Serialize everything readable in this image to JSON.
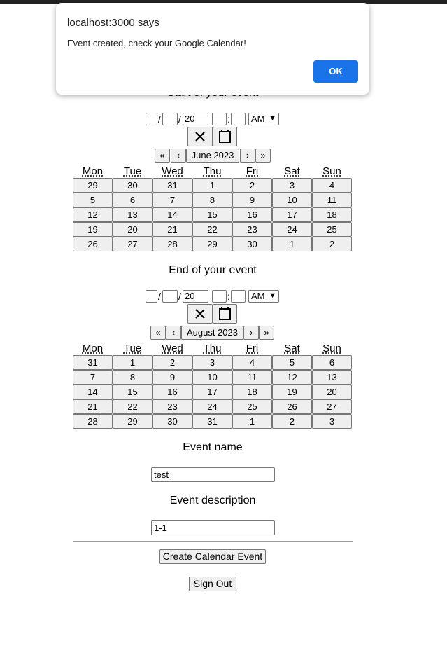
{
  "start": {
    "title": "Start of your event",
    "year_value": "20",
    "ampm": "AM",
    "clear_icon": "close-icon",
    "calendar_icon": "calendar-icon",
    "nav": {
      "prev2": "«",
      "prev": "‹",
      "label": "June 2023",
      "next": "›",
      "next2": "»"
    },
    "weekdays": [
      "Mon",
      "Tue",
      "Wed",
      "Thu",
      "Fri",
      "Sat",
      "Sun"
    ],
    "days": [
      "29",
      "30",
      "31",
      "1",
      "2",
      "3",
      "4",
      "5",
      "6",
      "7",
      "8",
      "9",
      "10",
      "11",
      "12",
      "13",
      "14",
      "15",
      "16",
      "17",
      "18",
      "19",
      "20",
      "21",
      "22",
      "23",
      "24",
      "25",
      "26",
      "27",
      "28",
      "29",
      "30",
      "1",
      "2"
    ]
  },
  "end": {
    "title": "End of your event",
    "year_value": "20",
    "ampm": "AM",
    "clear_icon": "close-icon",
    "calendar_icon": "calendar-icon",
    "nav": {
      "prev2": "«",
      "prev": "‹",
      "label": "August 2023",
      "next": "›",
      "next2": "»"
    },
    "weekdays": [
      "Mon",
      "Tue",
      "Wed",
      "Thu",
      "Fri",
      "Sat",
      "Sun"
    ],
    "days": [
      "31",
      "1",
      "2",
      "3",
      "4",
      "5",
      "6",
      "7",
      "8",
      "9",
      "10",
      "11",
      "12",
      "13",
      "14",
      "15",
      "16",
      "17",
      "18",
      "19",
      "20",
      "21",
      "22",
      "23",
      "24",
      "25",
      "26",
      "27",
      "28",
      "29",
      "30",
      "31",
      "1",
      "2",
      "3"
    ]
  },
  "form": {
    "name_label": "Event name",
    "name_value": "test",
    "description_label": "Event description",
    "description_value": "1-1",
    "create_button": "Create Calendar Event",
    "signout_button": "Sign Out"
  },
  "dialog": {
    "title": "localhost:3000 says",
    "message": "Event created, check your Google Calendar!",
    "ok_label": "OK",
    "ok_color": "#1a73e8"
  }
}
